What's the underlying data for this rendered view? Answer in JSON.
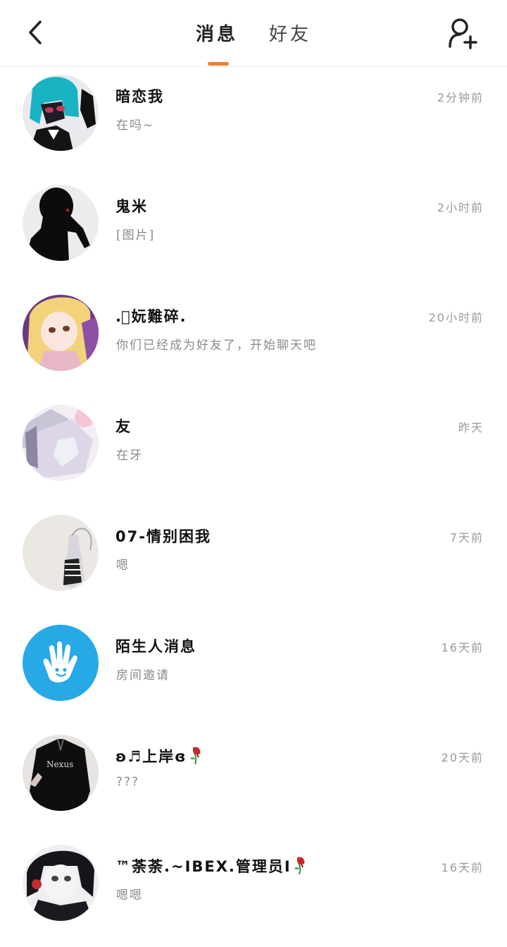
{
  "header": {
    "tabs": [
      {
        "label": "消息",
        "active": true
      },
      {
        "label": "好友",
        "active": false
      }
    ],
    "accent_color": "#f47c2a",
    "back_icon": "chevron-left-icon",
    "add_icon": "add-user-icon"
  },
  "conversations": [
    {
      "name": "暗恋我",
      "preview": "在吗~",
      "time": "2分钟前",
      "avatar": "anime-teal-hair"
    },
    {
      "name": "鬼米",
      "preview": "[图片]",
      "time": "2小时前",
      "avatar": "silhouette"
    },
    {
      "name": ".ﾞ妧難碎.",
      "preview": "你们已经成为好友了，开始聊天吧",
      "time": "20小时前",
      "avatar": "anime-blonde"
    },
    {
      "name": "友",
      "preview": "在牙",
      "time": "昨天",
      "avatar": "pastel-abstract"
    },
    {
      "name": "07-情别困我",
      "preview": "嗯",
      "time": "7天前",
      "avatar": "sketch-girl"
    },
    {
      "name": "陌生人消息",
      "preview": "房间邀请",
      "time": "16天前",
      "avatar": "blue-hand"
    },
    {
      "name": "ʚ♬上岸ɞ",
      "preview": "???",
      "time": "20天前",
      "avatar": "black-hoodie",
      "emoji": "wilted-rose"
    },
    {
      "name": "™荼荼.~IBEX.管理员I",
      "preview": "嗯嗯",
      "time": "16天前",
      "avatar": "anime-dark",
      "emoji": "wilted-rose"
    }
  ]
}
